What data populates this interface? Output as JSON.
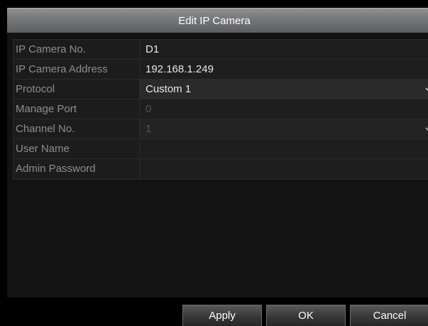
{
  "dialog": {
    "title": "Edit IP Camera"
  },
  "form": {
    "fields": [
      {
        "label": "IP Camera No.",
        "value": "D1"
      },
      {
        "label": "IP Camera Address",
        "value": "192.168.1.249"
      },
      {
        "label": "Protocol",
        "value": "Custom 1",
        "icon": "chevron-down-icon"
      },
      {
        "label": "Manage Port",
        "value": "0"
      },
      {
        "label": "Channel No.",
        "value": "1",
        "icon": "chevron-down-icon"
      },
      {
        "label": "User Name",
        "value": ""
      },
      {
        "label": "Admin Password",
        "value": ""
      }
    ]
  },
  "buttons": {
    "apply": "Apply",
    "ok": "OK",
    "cancel": "Cancel"
  },
  "colors": {
    "background": "#000000",
    "panel": "#1c1c1c",
    "label_text": "#8e8e8e",
    "value_text": "#e8e8e8",
    "disabled_text": "#555555"
  }
}
